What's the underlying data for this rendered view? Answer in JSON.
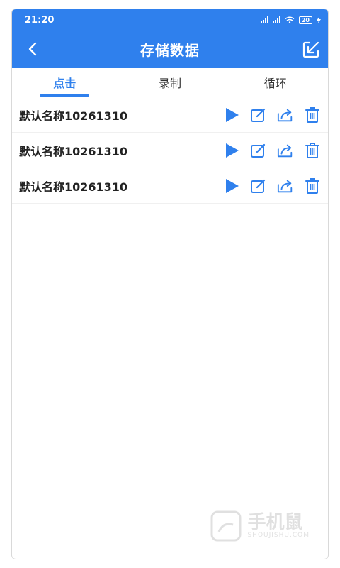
{
  "status_bar": {
    "time": "21:20",
    "battery": "20"
  },
  "app_bar": {
    "title": "存储数据"
  },
  "tabs": [
    {
      "label": "点击",
      "active": true
    },
    {
      "label": "录制",
      "active": false
    },
    {
      "label": "循环",
      "active": false
    }
  ],
  "list": [
    {
      "name": "默认名称10261310"
    },
    {
      "name": "默认名称10261310"
    },
    {
      "name": "默认名称10261310"
    }
  ],
  "colors": {
    "accent": "#2f80ed"
  },
  "watermark": {
    "main": "手机鼠",
    "sub": "SHOUJISHU.COM"
  }
}
